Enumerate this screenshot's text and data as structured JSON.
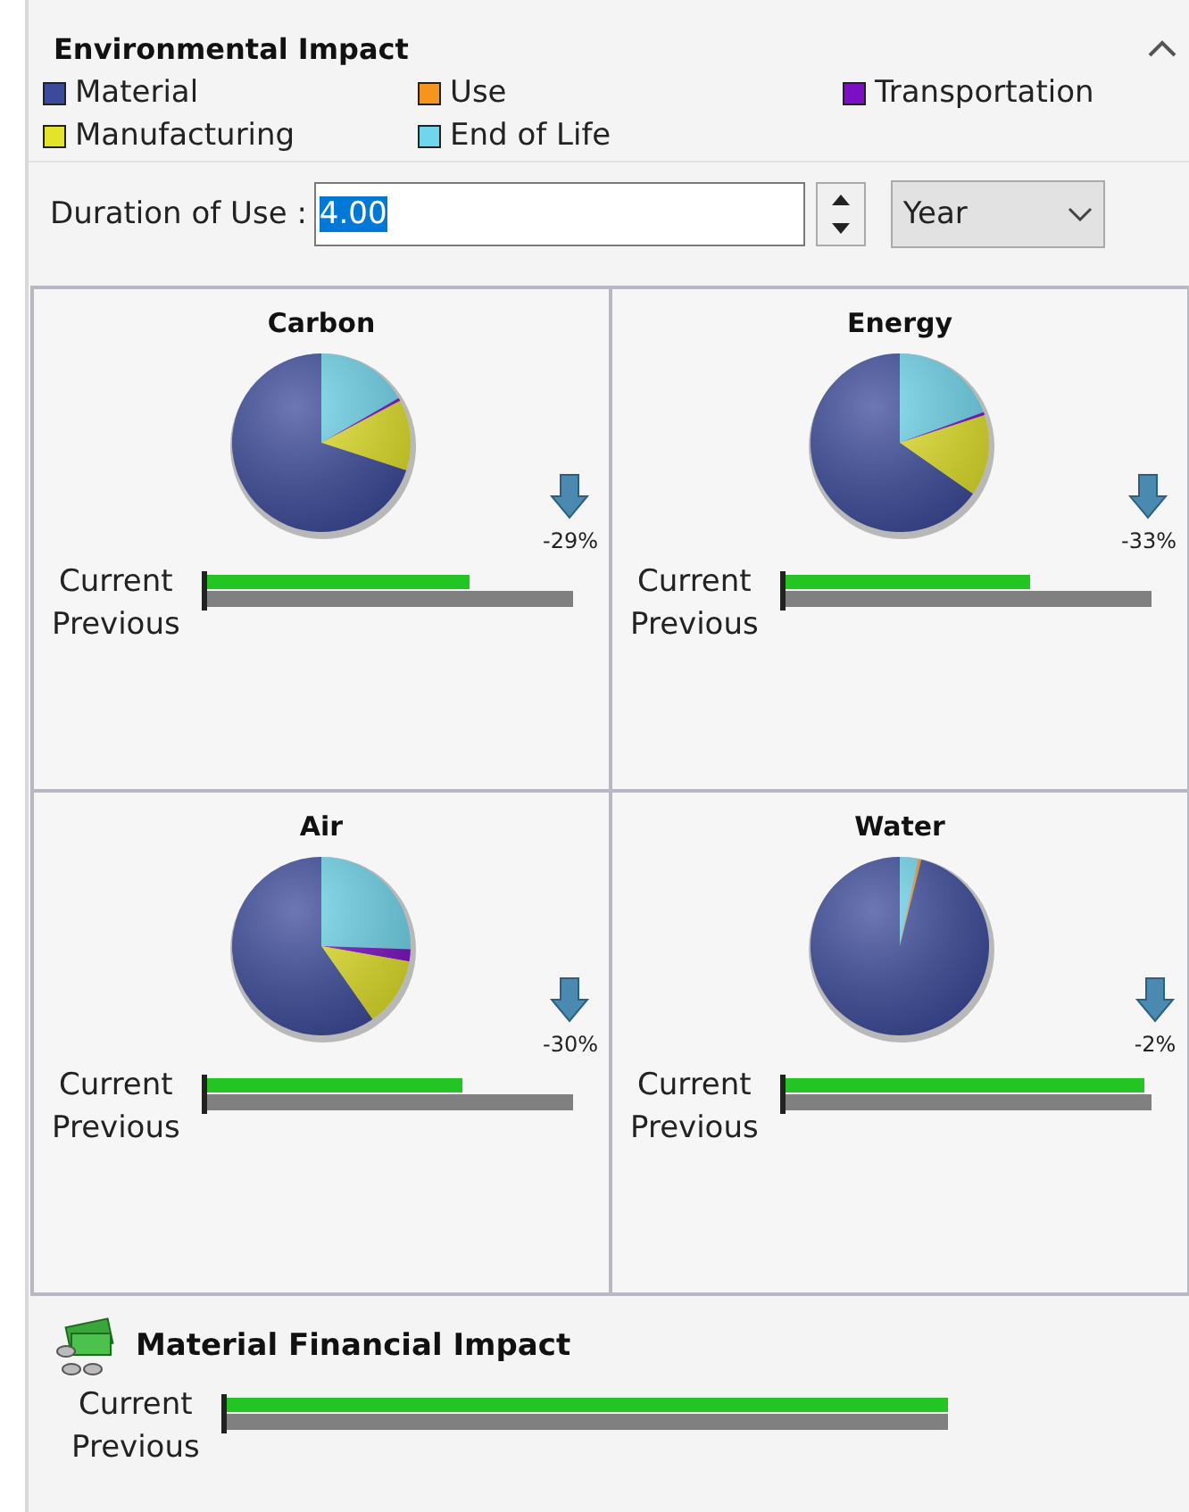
{
  "section": {
    "title": "Environmental Impact",
    "expanded": true
  },
  "legend": [
    {
      "label": "Material",
      "color": "#3b4a9a"
    },
    {
      "label": "Use",
      "color": "#f7941d"
    },
    {
      "label": "Transportation",
      "color": "#7b0fc4"
    },
    {
      "label": "Manufacturing",
      "color": "#e3e32a"
    },
    {
      "label": "End of Life",
      "color": "#6fd6ec"
    }
  ],
  "duration": {
    "label": "Duration of Use :",
    "value": "4.00",
    "unit": "Year"
  },
  "impacts": [
    {
      "title": "Carbon",
      "change": "-29%",
      "current": {
        "label": "Current",
        "level": 0.72
      },
      "previous": {
        "label": "Previous",
        "level": 1
      }
    },
    {
      "title": "Energy",
      "change": "-33%",
      "current": {
        "label": "Current",
        "level": 0.67
      },
      "previous": {
        "label": "Previous",
        "level": 1
      }
    },
    {
      "title": "Air",
      "change": "-30%",
      "current": {
        "label": "Current",
        "level": 0.7
      },
      "previous": {
        "label": "Previous",
        "level": 1
      }
    },
    {
      "title": "Water",
      "change": "-2%",
      "current": {
        "label": "Current",
        "level": 0.98
      },
      "previous": {
        "label": "Previous",
        "level": 1
      }
    }
  ],
  "financial": {
    "title": "Material Financial Impact",
    "current": {
      "label": "Current",
      "level": 1
    },
    "previous": {
      "label": "Previous",
      "level": 1
    }
  }
}
